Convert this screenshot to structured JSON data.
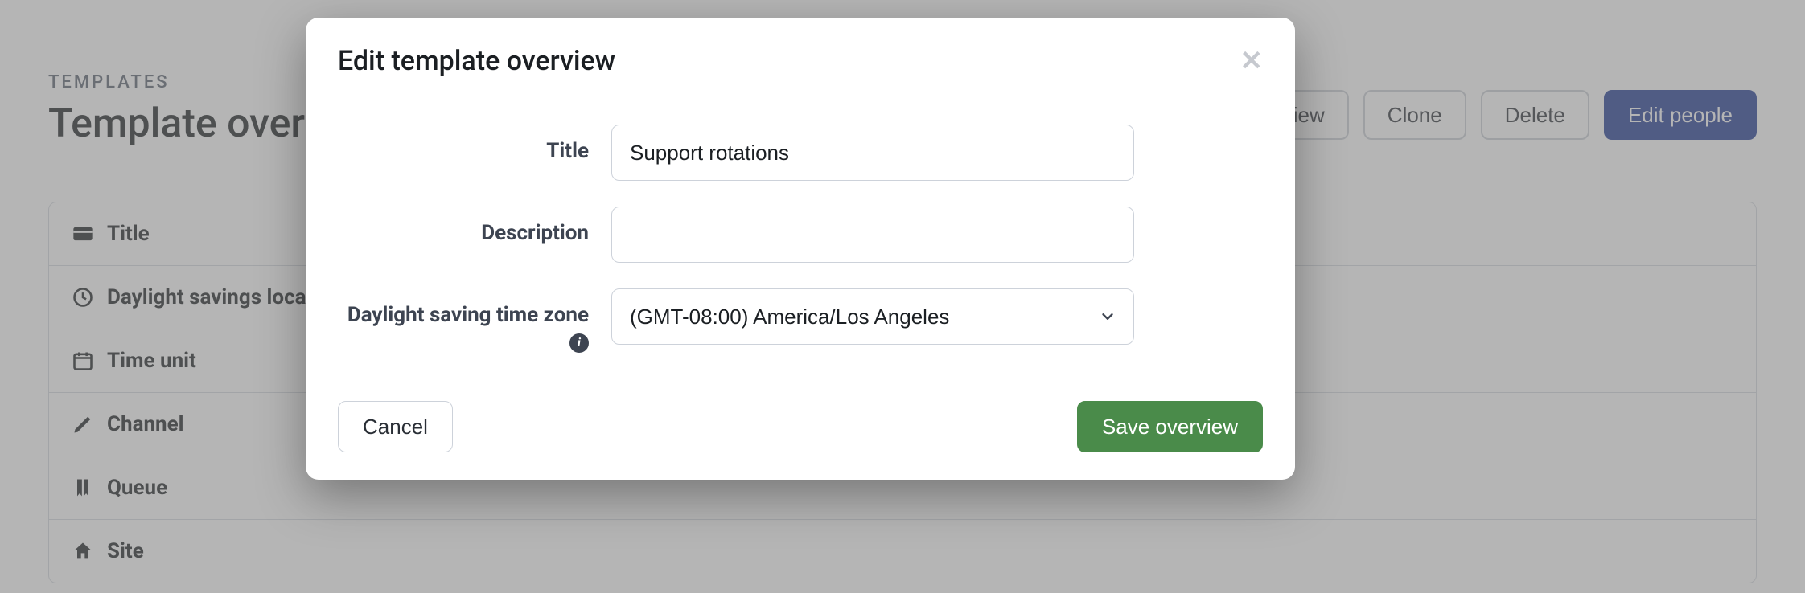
{
  "breadcrumb": "TEMPLATES",
  "page_title": "Template overview",
  "actions": {
    "overview": "Edit overview",
    "clone": "Clone",
    "delete": "Delete",
    "people": "Edit people"
  },
  "rows": {
    "title": "Title",
    "dst": "Daylight savings location",
    "timeunit": "Time unit",
    "channel": "Channel",
    "queue": "Queue",
    "site": "Site"
  },
  "modal": {
    "heading": "Edit template overview",
    "close": "✕",
    "labels": {
      "title": "Title",
      "description": "Description",
      "tz": "Daylight saving time zone"
    },
    "values": {
      "title": "Support rotations",
      "description": "",
      "tz": "(GMT-08:00) America/Los Angeles"
    },
    "buttons": {
      "cancel": "Cancel",
      "save": "Save overview"
    }
  }
}
